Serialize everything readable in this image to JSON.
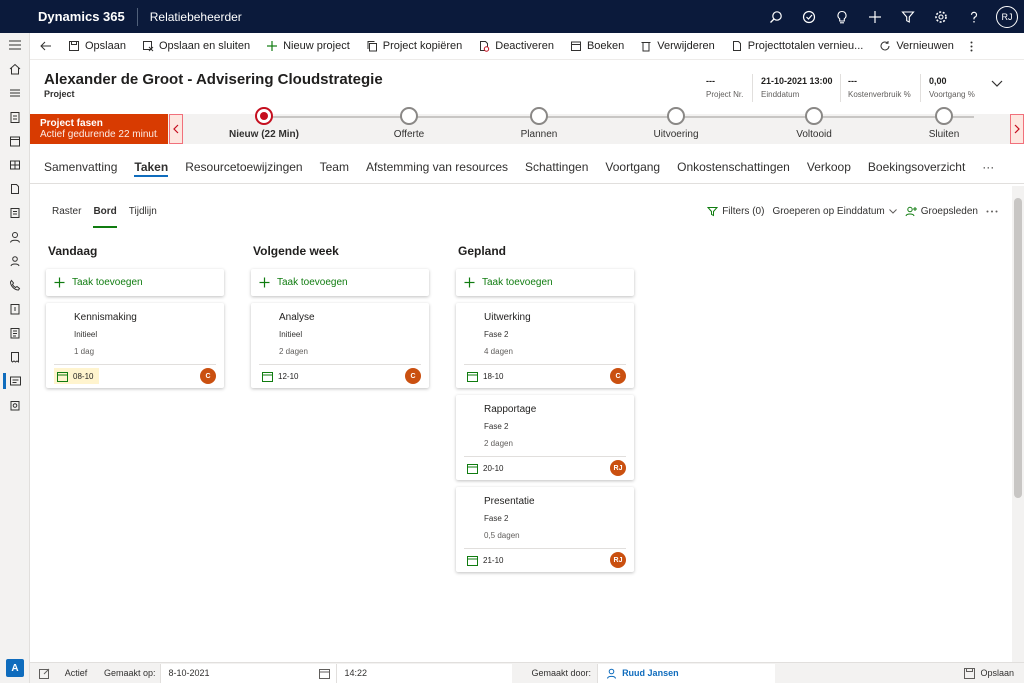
{
  "app": {
    "brand": "Dynamics 365",
    "area": "Relatiebeheerder",
    "user_initials": "RJ",
    "area_badge": "A"
  },
  "topbar_icons": [
    "search-icon",
    "task-check-icon",
    "lightbulb-icon",
    "plus-icon",
    "filter-icon",
    "gear-icon",
    "help-icon"
  ],
  "commands": [
    {
      "label": "Opslaan",
      "icon": "save-icon"
    },
    {
      "label": "Opslaan en sluiten",
      "icon": "save-close-icon"
    },
    {
      "label": "Nieuw project",
      "icon": "plus-icon"
    },
    {
      "label": "Project kopiëren",
      "icon": "copy-icon"
    },
    {
      "label": "Deactiveren",
      "icon": "deactivate-icon"
    },
    {
      "label": "Boeken",
      "icon": "book-icon"
    },
    {
      "label": "Verwijderen",
      "icon": "delete-icon"
    },
    {
      "label": "Projecttotalen vernieu...",
      "icon": "document-icon"
    },
    {
      "label": "Vernieuwen",
      "icon": "refresh-icon"
    }
  ],
  "header": {
    "title": "Alexander de Groot - Advisering Cloudstrategie",
    "entity": "Project",
    "fields": [
      {
        "value": "---",
        "label": "Project Nr."
      },
      {
        "value": "21-10-2021 13:00",
        "label": "Einddatum"
      },
      {
        "value": "---",
        "label": "Kostenverbruik %"
      },
      {
        "value": "0,00",
        "label": "Voortgang %"
      }
    ]
  },
  "bpf": {
    "active_title": "Project fasen",
    "active_sub": "Actief gedurende 22 minut...",
    "stages": [
      "Nieuw  (22 Min)",
      "Offerte",
      "Plannen",
      "Uitvoering",
      "Voltooid",
      "Sluiten"
    ]
  },
  "tabs": [
    "Samenvatting",
    "Taken",
    "Resourcetoewijzingen",
    "Team",
    "Afstemming van resources",
    "Schattingen",
    "Voortgang",
    "Onkostenschattingen",
    "Verkoop",
    "Boekingsoverzicht",
    "···"
  ],
  "active_tab": 1,
  "views": [
    "Raster",
    "Bord",
    "Tijdlijn"
  ],
  "view_tools": {
    "filters": "Filters (0)",
    "group": "Groeperen op Einddatum",
    "members": "Groepsleden"
  },
  "add_task_label": "Taak toevoegen",
  "columns": [
    {
      "title": "Vandaag",
      "cards": [
        {
          "title": "Kennismaking",
          "phase": "Initieel",
          "duration": "1 dag",
          "date": "08-10",
          "assignee": "C",
          "today": true
        }
      ]
    },
    {
      "title": "Volgende week",
      "cards": [
        {
          "title": "Analyse",
          "phase": "Initieel",
          "duration": "2 dagen",
          "date": "12-10",
          "assignee": "C",
          "today": false
        }
      ]
    },
    {
      "title": "Gepland",
      "cards": [
        {
          "title": "Uitwerking",
          "phase": "Fase 2",
          "duration": "4 dagen",
          "date": "18-10",
          "assignee": "C",
          "today": false
        },
        {
          "title": "Rapportage",
          "phase": "Fase 2",
          "duration": "2 dagen",
          "date": "20-10",
          "assignee": "RJ",
          "today": false
        },
        {
          "title": "Presentatie",
          "phase": "Fase 2",
          "duration": "0,5 dagen",
          "date": "21-10",
          "assignee": "RJ",
          "today": false
        }
      ]
    }
  ],
  "footer": {
    "status": "Actief",
    "created_on_label": "Gemaakt op:",
    "created_on_date": "8-10-2021",
    "created_on_time": "14:22",
    "created_by_label": "Gemaakt door:",
    "created_by": "Ruud Jansen",
    "save": "Opslaan"
  },
  "colors": {
    "nav": "#0b1a3b",
    "accent_red": "#d83b01",
    "green": "#107c10",
    "avatar": "#ca5010"
  }
}
